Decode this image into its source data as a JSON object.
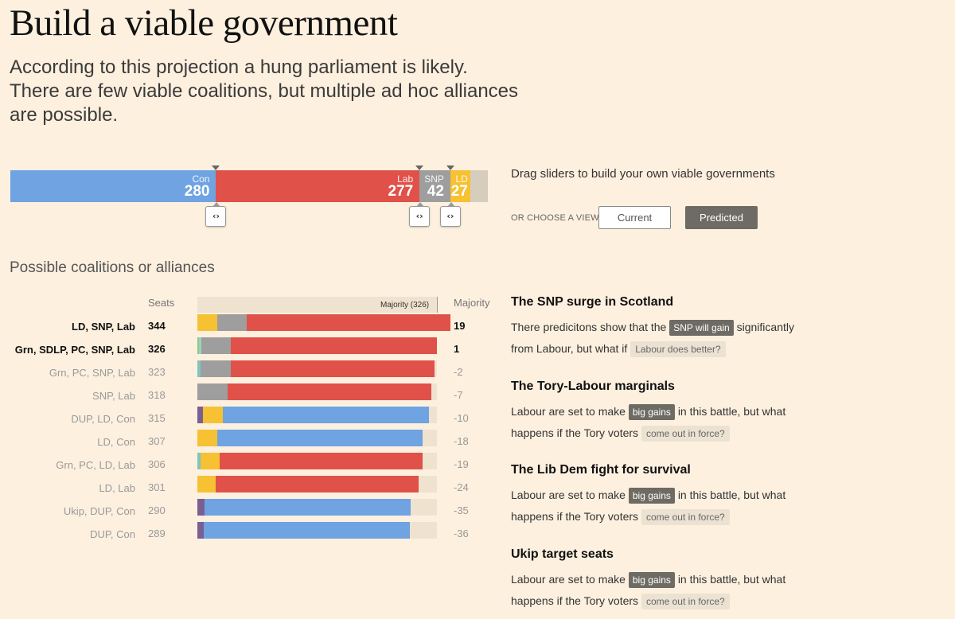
{
  "header": {
    "title": "Build a viable government",
    "subtitle": "According to this projection a hung parliament is likely. There are few viable coalitions, but multiple ad hoc alliances are possible."
  },
  "seat_bar": {
    "total": 650,
    "parties": [
      {
        "name": "Con",
        "seats": 280,
        "color": "#6fa3e2"
      },
      {
        "name": "Lab",
        "seats": 277,
        "color": "#e05149"
      },
      {
        "name": "SNP",
        "seats": 42,
        "color": "#9e9e9e"
      },
      {
        "name": "LD",
        "seats": 27,
        "color": "#f6c132"
      },
      {
        "name": "",
        "seats": 24,
        "color": "#d6cdbd"
      }
    ],
    "handle_icon": "‹›"
  },
  "controls": {
    "drag_hint": "Drag sliders to build your own viable governments",
    "choose_label": "OR CHOOSE A VIEW",
    "current_label": "Current",
    "predicted_label": "Predicted",
    "selected_view": "Predicted"
  },
  "coalitions": {
    "title": "Possible coalitions or alliances",
    "seats_header": "Seats",
    "majority_header": "Majority",
    "majority_marker_label": "Majority (326)",
    "majority_seats": 326,
    "party_colors": {
      "LD": "#f6c132",
      "SNP": "#9e9e9e",
      "Lab": "#e05149",
      "Grn": "#8fc97c",
      "SDLP": "#9ad1c3",
      "PC": "#7fc4c0",
      "DUP": "#7a5f93",
      "Con": "#6fa3e2",
      "Ukip": "#7a5f93"
    },
    "rows": [
      {
        "label": "LD, SNP, Lab",
        "seats": "344",
        "majority": "19",
        "emphasis": "bold",
        "segments": [
          {
            "party": "LD",
            "seats": 27
          },
          {
            "party": "SNP",
            "seats": 40
          },
          {
            "party": "Lab",
            "seats": 277
          }
        ]
      },
      {
        "label": "Grn, SDLP, PC, SNP, Lab",
        "seats": "326",
        "majority": "1",
        "emphasis": "bold",
        "segments": [
          {
            "party": "Grn",
            "seats": 2
          },
          {
            "party": "SDLP",
            "seats": 3
          },
          {
            "party": "SNP",
            "seats": 40
          },
          {
            "party": "Lab",
            "seats": 281
          }
        ]
      },
      {
        "label": "Grn, PC, SNP, Lab",
        "seats": "323",
        "majority": "-2",
        "emphasis": "dim",
        "segments": [
          {
            "party": "PC",
            "seats": 4
          },
          {
            "party": "SNP",
            "seats": 42
          },
          {
            "party": "Lab",
            "seats": 277
          }
        ]
      },
      {
        "label": "SNP, Lab",
        "seats": "318",
        "majority": "-7",
        "emphasis": "dim",
        "segments": [
          {
            "party": "SNP",
            "seats": 41
          },
          {
            "party": "Lab",
            "seats": 277
          }
        ]
      },
      {
        "label": "DUP, LD, Con",
        "seats": "315",
        "majority": "-10",
        "emphasis": "dim",
        "segments": [
          {
            "party": "DUP",
            "seats": 8
          },
          {
            "party": "LD",
            "seats": 27
          },
          {
            "party": "Con",
            "seats": 280
          }
        ]
      },
      {
        "label": "LD, Con",
        "seats": "307",
        "majority": "-18",
        "emphasis": "dim",
        "segments": [
          {
            "party": "LD",
            "seats": 27
          },
          {
            "party": "Con",
            "seats": 280
          }
        ]
      },
      {
        "label": "Grn, PC, LD, Lab",
        "seats": "306",
        "majority": "-19",
        "emphasis": "dim",
        "segments": [
          {
            "party": "PC",
            "seats": 4
          },
          {
            "party": "LD",
            "seats": 26
          },
          {
            "party": "Lab",
            "seats": 276
          }
        ]
      },
      {
        "label": "LD, Lab",
        "seats": "301",
        "majority": "-24",
        "emphasis": "dim",
        "segments": [
          {
            "party": "LD",
            "seats": 25
          },
          {
            "party": "Lab",
            "seats": 276
          }
        ]
      },
      {
        "label": "Ukip, DUP, Con",
        "seats": "290",
        "majority": "-35",
        "emphasis": "dim",
        "segments": [
          {
            "party": "Ukip",
            "seats": 10
          },
          {
            "party": "Con",
            "seats": 280
          }
        ]
      },
      {
        "label": "DUP, Con",
        "seats": "289",
        "majority": "-36",
        "emphasis": "dim",
        "segments": [
          {
            "party": "DUP",
            "seats": 9
          },
          {
            "party": "Con",
            "seats": 280
          }
        ]
      }
    ]
  },
  "stories": [
    {
      "title": "The SNP surge in Scotland",
      "line1_pre": "There predicitons show that the",
      "pill_dark": "SNP will gain",
      "line1_post": "significantly",
      "line2_pre": "from Labour, but what if",
      "pill_light": "Labour does better?"
    },
    {
      "title": "The Tory-Labour marginals",
      "line1_pre": "Labour are set to make",
      "pill_dark": "big gains",
      "line1_post": "in this battle, but what",
      "line2_pre": "happens if the Tory voters",
      "pill_light": "come out in force?"
    },
    {
      "title": "The Lib Dem fight for survival",
      "line1_pre": "Labour are set to make",
      "pill_dark": "big gains",
      "line1_post": "in this battle, but what",
      "line2_pre": "happens if the Tory voters",
      "pill_light": "come out in force?"
    },
    {
      "title": "Ukip target seats",
      "line1_pre": "Labour are set to make",
      "pill_dark": "big gains",
      "line1_post": "in this battle, but what",
      "line2_pre": "happens if the Tory voters",
      "pill_light": "come out in force?"
    }
  ]
}
